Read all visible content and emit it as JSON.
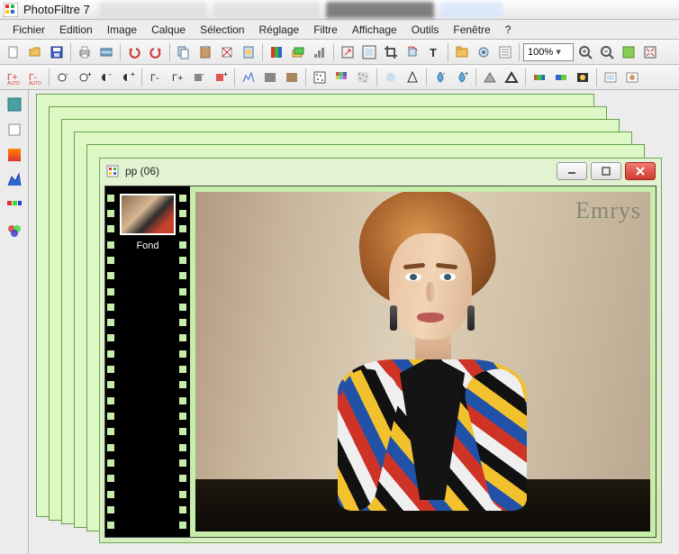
{
  "app": {
    "title": "PhotoFiltre 7"
  },
  "menus": [
    "Fichier",
    "Edition",
    "Image",
    "Calque",
    "Sélection",
    "Réglage",
    "Filtre",
    "Affichage",
    "Outils",
    "Fenêtre",
    "?"
  ],
  "zoom": {
    "value": "100%"
  },
  "doc": {
    "title": "pp (06)",
    "layer_label": "Fond",
    "watermark": "Emrys"
  }
}
